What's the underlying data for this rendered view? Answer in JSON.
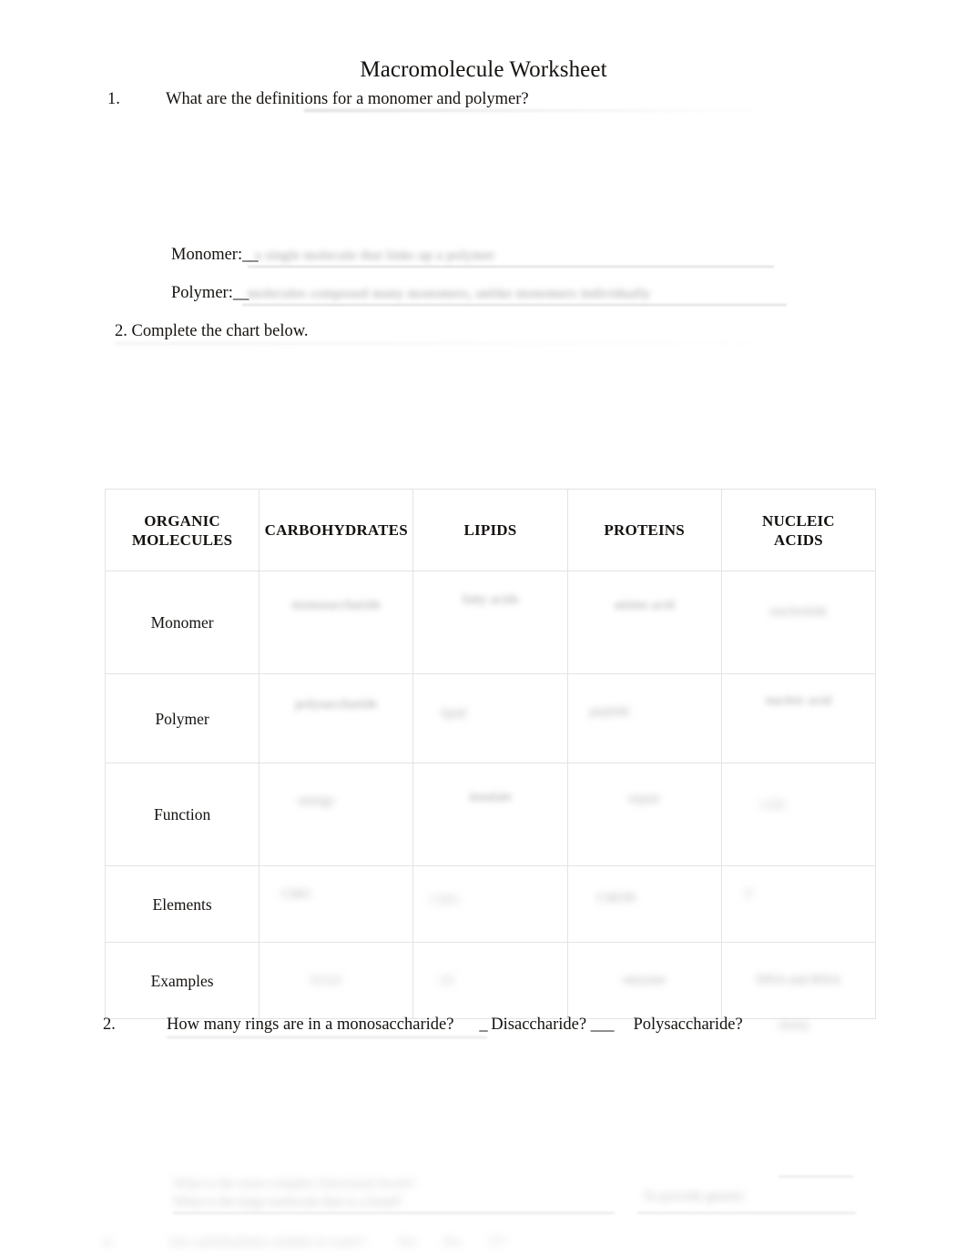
{
  "document": {
    "title": "Macromolecule Worksheet"
  },
  "question1": {
    "number": "1.",
    "text": "What are the definitions for a monomer and polymer?",
    "monomer_label": "Monomer:",
    "monomer_dash": "__",
    "monomer_answer": "a single molecule that links up a polymer",
    "polymer_label": "Polymer:",
    "polymer_dash": "__",
    "polymer_answer": "molecules composed many monomers, unlike monomers individually"
  },
  "question2": {
    "text": "2. Complete the chart below."
  },
  "table": {
    "headers": [
      "ORGANIC MOLECULES",
      "CARBOHYDRATES",
      "LIPIDS",
      "PROTEINS",
      "NUCLEIC ACIDS"
    ],
    "header_lines": {
      "organic": [
        "ORGANIC",
        "MOLECULES"
      ],
      "nucleic": [
        "NUCLEIC",
        "ACIDS"
      ]
    },
    "rows": [
      {
        "label": "Monomer",
        "cells": [
          "monosaccharide",
          "fatty acids",
          "amino acid",
          "nucleotide"
        ]
      },
      {
        "label": "Polymer",
        "cells": [
          "polysaccharide",
          "lipid",
          "peptide",
          "nucleic acid"
        ]
      },
      {
        "label": "Function",
        "cells": [
          "energy",
          "insulate",
          "repair",
          "code"
        ]
      },
      {
        "label": "Elements",
        "cells": [
          "CHO",
          "CHO",
          "CHON",
          "P"
        ]
      },
      {
        "label": "Examples",
        "cells": [
          "bread",
          "oil",
          "enzyme",
          "DNA and RNA"
        ]
      }
    ]
  },
  "question3": {
    "number": "2.",
    "text_monosaccharide": "How many rings are in a monosaccharide?",
    "blank_1": "_",
    "text_disaccharide": "Disaccharide?",
    "blank_2": "___",
    "text_polysaccharide": "Polysaccharide?",
    "answer_polysaccharide": "many"
  },
  "bottom": {
    "line_1": "What is the most complex functional levels?",
    "line_2": "What is the large molecule that is a bond?",
    "line_3": "To provide genetic",
    "line_4_number": "4.",
    "line_4_text": "Are carbohydrates soluble in water?",
    "line_4_opt1": "Yes",
    "line_4_opt2": "No",
    "line_4_opt3": "???"
  }
}
